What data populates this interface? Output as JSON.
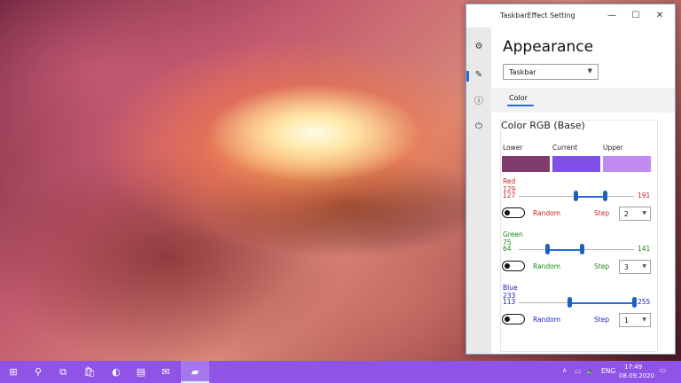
{
  "window": {
    "title": "TaskbarEffect Setting",
    "controls": {
      "minimize": "—",
      "maximize": "☐",
      "close": "✕"
    }
  },
  "nav": {
    "icons": [
      "gear-icon",
      "appearance-icon",
      "info-icon",
      "power-icon"
    ]
  },
  "page": {
    "title": "Appearance",
    "target_select": {
      "value": "Taskbar"
    },
    "tabs": [
      {
        "label": "Color",
        "selected": true
      }
    ]
  },
  "color_card": {
    "title": "Color RGB (Base)",
    "swatches": [
      {
        "label": "Lower",
        "color": "#7f3b6b"
      },
      {
        "label": "Current",
        "color": "#8150e6"
      },
      {
        "label": "Upper",
        "color": "#c08af0"
      }
    ],
    "channels": [
      {
        "name": "Red",
        "value": "129",
        "min": "127",
        "max": "191",
        "color": "#d12020",
        "random_label": "Random",
        "random_on": false,
        "step_label": "Step",
        "step_value": "2",
        "range_min": 0,
        "range_max": 255
      },
      {
        "name": "Green",
        "value": "75",
        "min": "64",
        "max": "141",
        "color": "#1a8a1a",
        "random_label": "Random",
        "random_on": false,
        "step_label": "Step",
        "step_value": "3",
        "range_min": 0,
        "range_max": 255
      },
      {
        "name": "Blue",
        "value": "233",
        "min": "113",
        "max": "255",
        "color": "#2020c8",
        "random_label": "Random",
        "random_on": false,
        "step_label": "Step",
        "step_value": "1",
        "range_min": 0,
        "range_max": 255
      }
    ]
  },
  "taskbar": {
    "color": "#8f53e6",
    "tray": {
      "language": "ENG",
      "time": "17:49",
      "date": "08.09.2020"
    }
  }
}
